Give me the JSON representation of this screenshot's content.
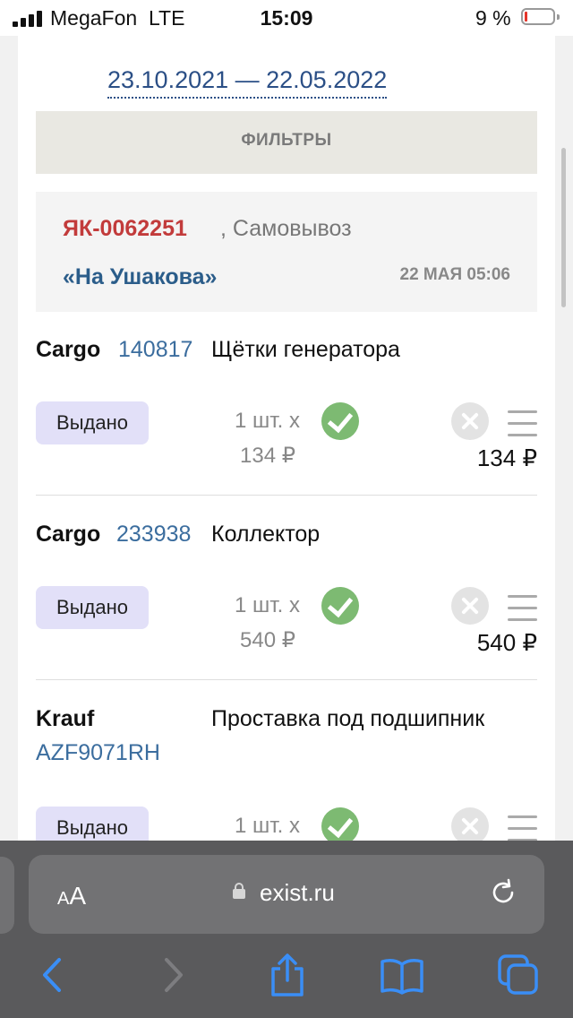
{
  "status_bar": {
    "carrier": "MegaFon",
    "network": "LTE",
    "time": "15:09",
    "battery": "9 %",
    "battery_level": 0.09
  },
  "filter_period": "23.10.2021 — 22.05.2022",
  "filters_label": "ФИЛЬТРЫ",
  "order": {
    "number": "ЯК-0062251",
    "delivery_type": ", Самовывоз",
    "store": "«На Ушакова»",
    "date": "22 МАЯ 05:06"
  },
  "items": [
    {
      "brand": "Cargo",
      "article": "140817",
      "title": "Щётки генератора",
      "status": "Выдано",
      "quantity": "1 шт. х",
      "unit_price": "134 ₽",
      "total": "134 ₽"
    },
    {
      "brand": "Cargo",
      "article": "233938",
      "title": "Коллектор",
      "status": "Выдано",
      "quantity": "1 шт. х",
      "unit_price": "540 ₽",
      "total": "540 ₽"
    },
    {
      "brand": "Krauf",
      "article": "AZF9071RH",
      "title": "Проставка под подшипник",
      "status": "Выдано",
      "quantity": "1 шт. х"
    }
  ],
  "browser": {
    "text_size_small": "A",
    "text_size_big": "A",
    "domain": "exist.ru"
  },
  "icons": [
    "signal-icon",
    "battery-icon",
    "check-icon",
    "cancel-icon",
    "menu-icon",
    "lock-icon",
    "reload-icon",
    "back-icon",
    "forward-icon",
    "share-icon",
    "bookmarks-icon",
    "tabs-icon"
  ],
  "colors": {
    "link_blue": "#2b4f86",
    "order_red": "#c23b3b",
    "status_badge": "#e2e0f8",
    "check_green": "#7dba72",
    "toolbar": "#5a5a5c",
    "ios_blue": "#3a8ef6"
  }
}
